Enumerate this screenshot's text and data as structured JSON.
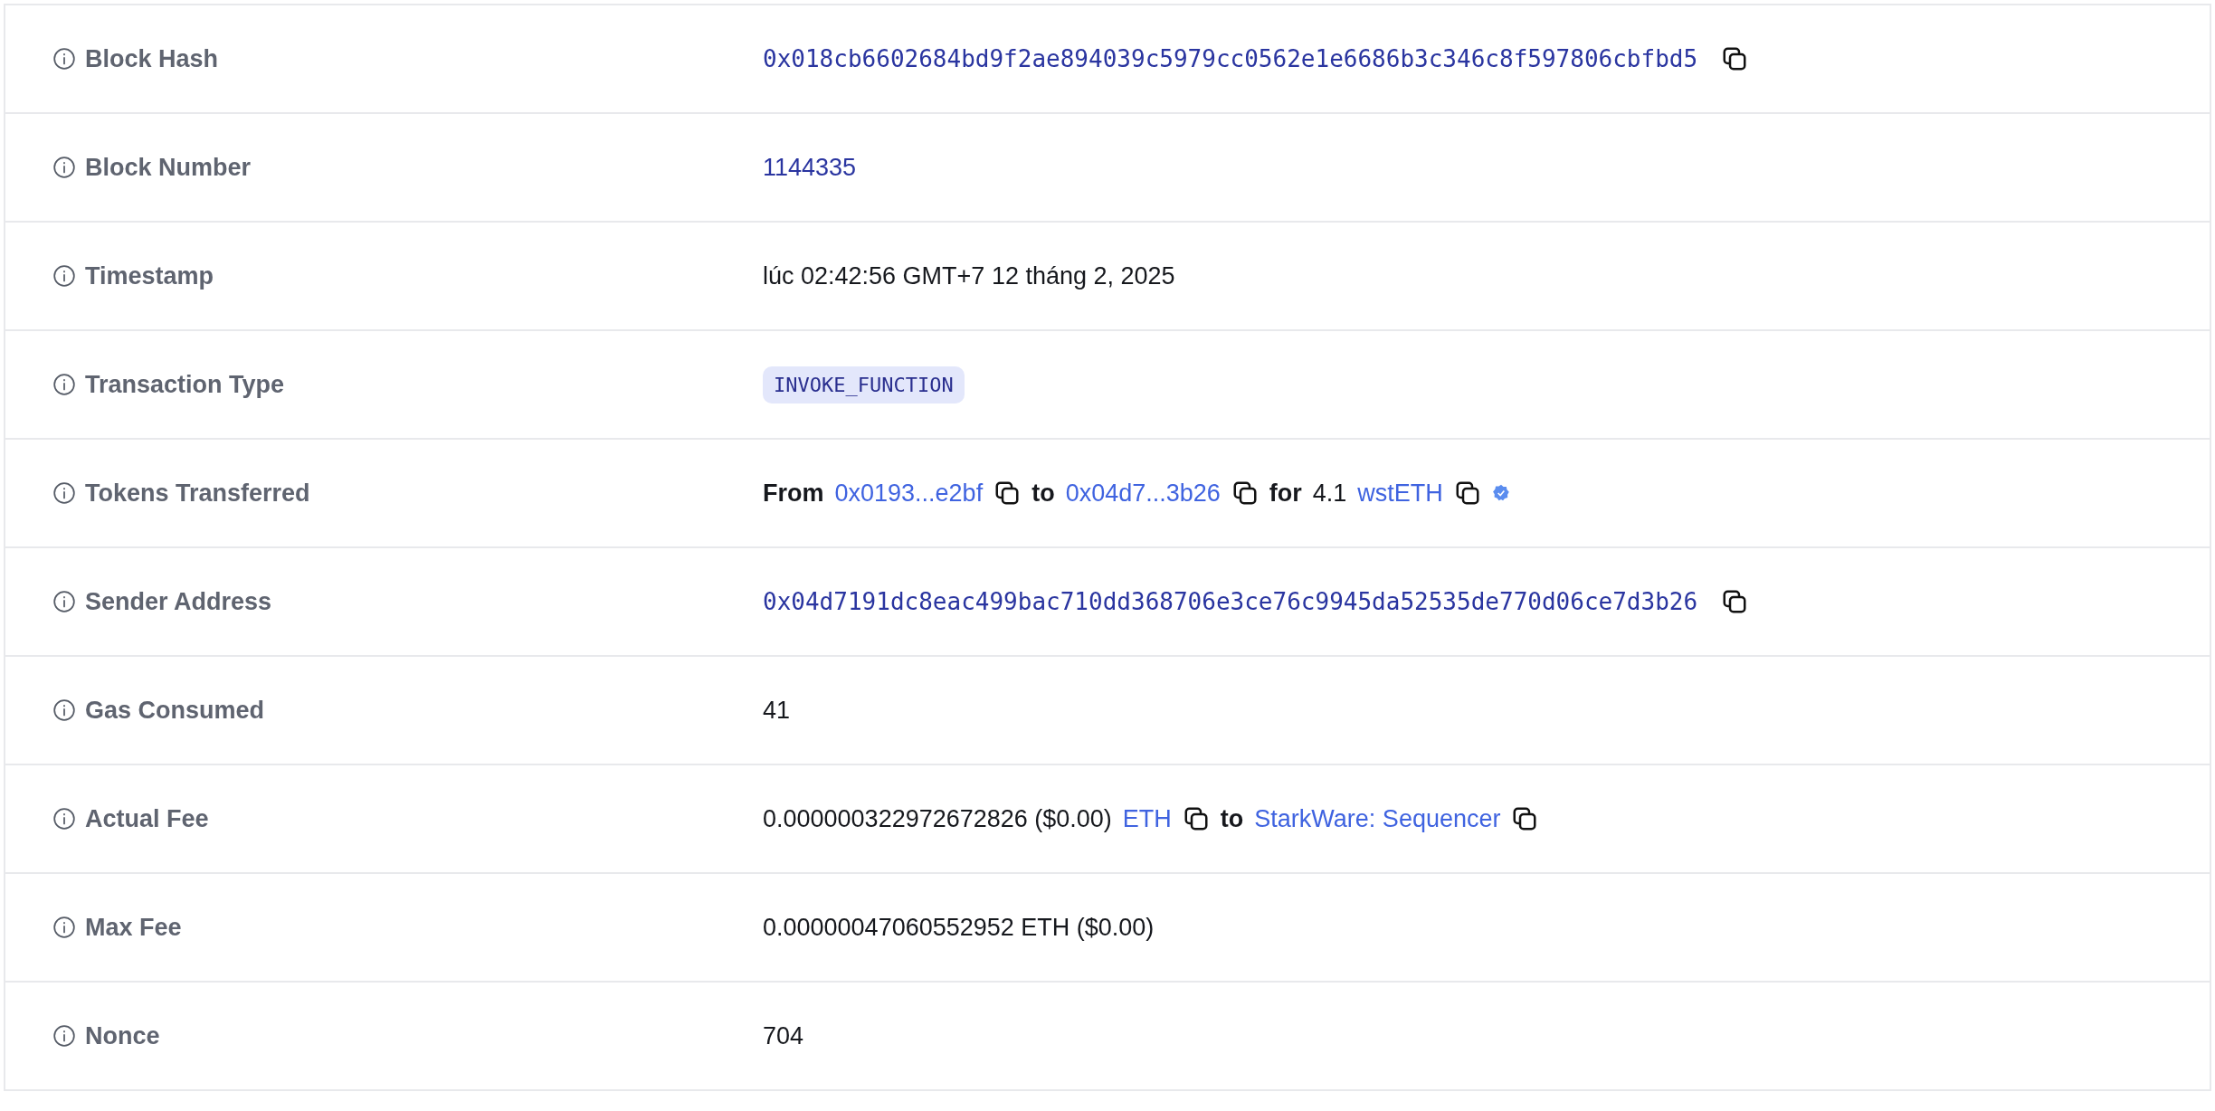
{
  "rows": [
    {
      "label": "Block Hash",
      "kind": "hash",
      "value": "0x018cb6602684bd9f2ae894039c5979cc0562e1e6686b3c346c8f597806cbfbd5"
    },
    {
      "label": "Block Number",
      "kind": "link",
      "value": "1144335"
    },
    {
      "label": "Timestamp",
      "kind": "text",
      "value": "lúc 02:42:56 GMT+7 12 tháng 2, 2025"
    },
    {
      "label": "Transaction Type",
      "kind": "badge",
      "value": "INVOKE_FUNCTION"
    },
    {
      "label": "Tokens Transferred",
      "kind": "parts",
      "parts": [
        {
          "kind": "bold",
          "text": "From"
        },
        {
          "kind": "link",
          "text": "0x0193...e2bf"
        },
        {
          "kind": "copy"
        },
        {
          "kind": "bold",
          "text": "to"
        },
        {
          "kind": "link",
          "text": "0x04d7...3b26"
        },
        {
          "kind": "copy"
        },
        {
          "kind": "bold",
          "text": "for"
        },
        {
          "kind": "text",
          "text": "4.1"
        },
        {
          "kind": "link",
          "text": "wstETH"
        },
        {
          "kind": "copy"
        },
        {
          "kind": "verified"
        }
      ]
    },
    {
      "label": "Sender Address",
      "kind": "hash",
      "value": "0x04d7191dc8eac499bac710dd368706e3ce76c9945da52535de770d06ce7d3b26"
    },
    {
      "label": "Gas Consumed",
      "kind": "text",
      "value": "41"
    },
    {
      "label": "Actual Fee",
      "kind": "parts",
      "parts": [
        {
          "kind": "text",
          "text": "0.000000322972672826 ($0.00)"
        },
        {
          "kind": "link",
          "text": "ETH"
        },
        {
          "kind": "copy"
        },
        {
          "kind": "bold",
          "text": "to"
        },
        {
          "kind": "link",
          "text": "StarkWare: Sequencer"
        },
        {
          "kind": "copy"
        }
      ]
    },
    {
      "label": "Max Fee",
      "kind": "text",
      "value": "0.00000047060552952 ETH ($0.00)"
    },
    {
      "label": "Nonce",
      "kind": "text",
      "value": "704"
    }
  ]
}
